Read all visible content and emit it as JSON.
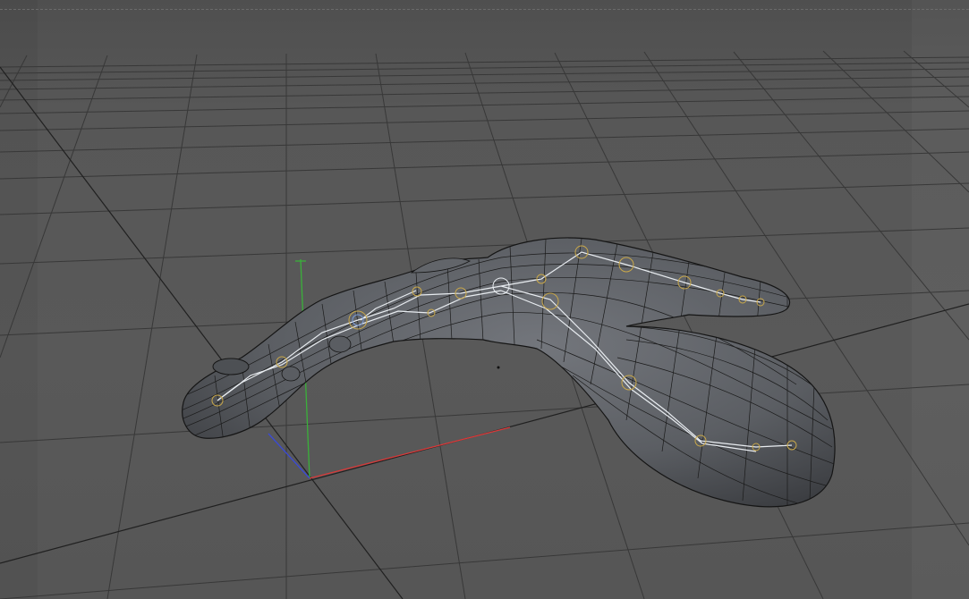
{
  "viewport": {
    "mode": "perspective",
    "background_color": "#585858",
    "grid_color": "#3a3a3a",
    "grid_major_color": "#1e1e1e"
  },
  "scene": {
    "object": {
      "type": "mesh",
      "wireframe_color": "#151515",
      "surface_color": "#5f6368"
    },
    "skeleton": {
      "bone_color": "#e8ecf0",
      "joint_ring_color": "#c9a84a",
      "joint_accent_color": "#7a9bd6"
    },
    "axis_gizmo": {
      "x_color": "#d63a3a",
      "y_color": "#3ab03a",
      "z_color": "#3a4ad6"
    }
  }
}
